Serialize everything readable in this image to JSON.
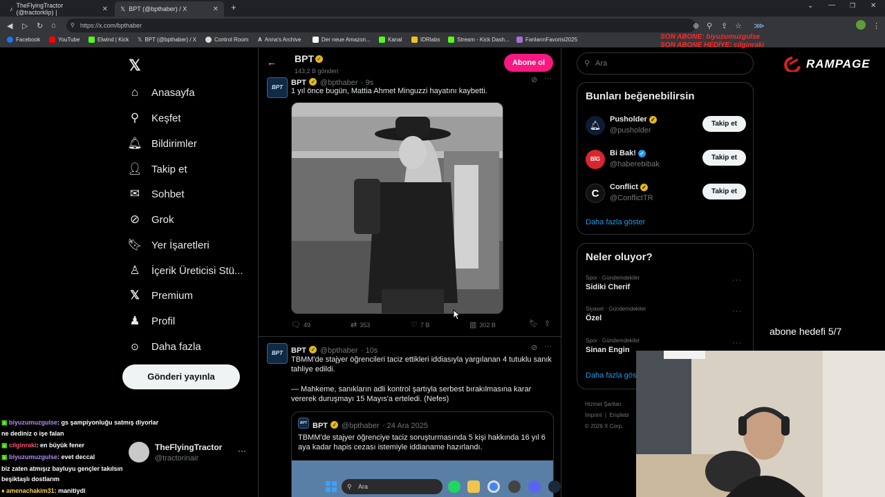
{
  "browser": {
    "tabs": [
      {
        "label": "TheFlyingTractor (@tractorklip) |"
      },
      {
        "label": "BPT (@bpthaber) / X"
      }
    ],
    "url": "https://x.com/bpthaber",
    "bookmarks": [
      {
        "label": "Facebook",
        "color": "#1877f2"
      },
      {
        "label": "YouTube",
        "color": "#ff0000"
      },
      {
        "label": "Elwind | Kick",
        "color": "#53fc18"
      },
      {
        "label": "BPT (@bpthaber) / X",
        "color": "#ffffff"
      },
      {
        "label": "Control Room",
        "color": "#dddddd"
      },
      {
        "label": "Anna's Archive",
        "color": "#dddddd"
      },
      {
        "label": "Der neue Amazon...",
        "color": "#ffffff"
      },
      {
        "label": "Kanal",
        "color": "#53fc18"
      },
      {
        "label": "IDRlabs",
        "color": "#f2c21a"
      },
      {
        "label": "Stream - Kick Dash...",
        "color": "#53fc18"
      },
      {
        "label": "FanlarınFavorisi2025",
        "color": "#a472d9"
      }
    ]
  },
  "overlay": {
    "alert_line1": "SON ABONE: biyuzumuzgulse",
    "alert_line2": "SON ABONE HEDİYE: cilginraki",
    "rampage": "RAMPAGE",
    "goal": "abone hedefi 5/7"
  },
  "nav": {
    "items": [
      {
        "label": "Anasayfa",
        "icon": "home-icon"
      },
      {
        "label": "Keşfet",
        "icon": "search-icon"
      },
      {
        "label": "Bildirimler",
        "icon": "bell-icon"
      },
      {
        "label": "Takip et",
        "icon": "add-user-icon"
      },
      {
        "label": "Sohbet",
        "icon": "mail-icon"
      },
      {
        "label": "Grok",
        "icon": "grok-icon"
      },
      {
        "label": "Yer İşaretleri",
        "icon": "bookmark-icon"
      },
      {
        "label": "İçerik Üreticisi Stü...",
        "icon": "creator-icon"
      },
      {
        "label": "Premium",
        "icon": "x-icon"
      },
      {
        "label": "Profil",
        "icon": "person-icon"
      },
      {
        "label": "Daha fazla",
        "icon": "more-icon"
      }
    ],
    "post_button": "Gönderi yayınla",
    "account": {
      "name": "TheFlyingTractor",
      "handle": "@tractorinair"
    }
  },
  "profile_header": {
    "name": "BPT",
    "posts_count": "143,2 B gönderi",
    "subscribe": "Abone ol"
  },
  "tweets": [
    {
      "name": "BPT",
      "handle": "@bpthaber",
      "time": "· 9s",
      "text": "1 yıl önce bugün, Mattia Ahmet Minguzzi hayatını kaybetti.",
      "replies": "49",
      "retweets": "353",
      "likes": "7 B",
      "views": "302 B"
    },
    {
      "name": "BPT",
      "handle": "@bpthaber",
      "time": "· 10s",
      "text": "TBMM'de stajyer öğrencileri taciz ettikleri iddiasıyla yargılanan 4 tutuklu sanık tahliye edildi.",
      "text2": "— Mahkeme, sanıkların adli kontrol şartıyla serbest bırakılmasına karar vererek duruşmayı 15 Mayıs'a erteledi. (Nefes)",
      "quote": {
        "name": "BPT",
        "handle": "@bpthaber",
        "date": "· 24 Ara 2025",
        "text": "TBMM'de stajyer öğrenciye taciz soruşturmasında 5 kişi hakkında 16 yıl 6 aya kadar hapis cezası istemiyle iddianame hazırlandı."
      }
    }
  ],
  "right": {
    "search_placeholder": "Ara",
    "who_to_follow": {
      "title": "Bunları beğenebilirsin",
      "items": [
        {
          "name": "Pusholder",
          "handle": "@pusholder",
          "button": "Takip et",
          "badge": "gold"
        },
        {
          "name": "Bi Bak!",
          "handle": "@haberebibak",
          "button": "Takip et",
          "badge": "blue"
        },
        {
          "name": "Conflict",
          "handle": "@ConflictTR",
          "button": "Takip et",
          "badge": "gold"
        }
      ],
      "more": "Daha fazla göster"
    },
    "trends": {
      "title": "Neler oluyor?",
      "items": [
        {
          "category": "Spor · Gündemdekiler",
          "name": "Sidiki Cherif"
        },
        {
          "category": "Siyaset · Gündemdekiler",
          "name": "Özel"
        },
        {
          "category": "Spor · Gündemdekiler",
          "name": "Sinan Engin"
        }
      ],
      "more": "Daha fazla göst"
    },
    "footer": {
      "line1": "Hizmet Şartları",
      "line2a": "İmprint",
      "line2b": "Erişilebi",
      "line3": "© 2026 X Corp."
    }
  },
  "chat": [
    {
      "user": "biyuzumuzgulse",
      "msg": ": gs şampiyonluğu satmış diyorlar",
      "cls": "u1"
    },
    {
      "user": "",
      "msg": "ne dediniz o işe falan",
      "cls": ""
    },
    {
      "user": "cilginraki",
      "msg": ": en büyük fener",
      "cls": "u2"
    },
    {
      "user": "biyuzumuzgulse",
      "msg": ": evet deccal",
      "cls": "u1"
    },
    {
      "user": "",
      "msg": "biz zaten atmışız bayluyu gençler takılsın",
      "cls": ""
    },
    {
      "user": "",
      "msg": "beşiktaşlı dostlarım",
      "cls": ""
    },
    {
      "user": "amenachakim31",
      "msg": ": manitiydi",
      "cls": "u3"
    }
  ],
  "taskbar": {
    "search": "Ara"
  }
}
